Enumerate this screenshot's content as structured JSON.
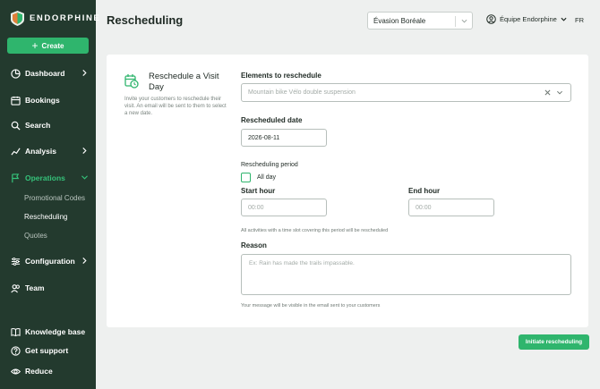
{
  "brand": {
    "name": "ENDORPHINE"
  },
  "sidebar": {
    "create_label": "Create",
    "items": [
      {
        "label": "Dashboard",
        "icon": "dashboard-icon"
      },
      {
        "label": "Bookings",
        "icon": "calendar-icon"
      },
      {
        "label": "Search",
        "icon": "search-icon"
      },
      {
        "label": "Analysis",
        "icon": "analysis-icon"
      },
      {
        "label": "Operations",
        "icon": "operations-icon"
      },
      {
        "label": "Configuration",
        "icon": "sliders-icon"
      },
      {
        "label": "Team",
        "icon": "team-icon"
      }
    ],
    "sub_items": [
      "Promotional Codes",
      "Rescheduling",
      "Quotes"
    ],
    "footer": [
      {
        "label": "Knowledge base",
        "icon": "book-icon"
      },
      {
        "label": "Get support",
        "icon": "help-icon"
      },
      {
        "label": "Reduce",
        "icon": "eye-icon"
      }
    ]
  },
  "header": {
    "title": "Rescheduling",
    "org_select": "Évasion Boréale",
    "user": "Équipe Endorphine",
    "lang": "FR"
  },
  "form": {
    "title": "Reschedule a Visit Day",
    "description": "Invite your customers to reschedule their visit. An email will be sent to them to select a new date.",
    "elements_label": "Elements to reschedule",
    "elements_value": "Mountain bike Vélo double suspension",
    "date_label": "Rescheduled date",
    "date_value": "2026-08-11",
    "period_label": "Rescheduling period",
    "all_day_label": "All day",
    "start_label": "Start hour",
    "start_placeholder": "00:00",
    "end_label": "End hour",
    "end_placeholder": "00:00",
    "period_help": "All activities with a time slot covering this period will be rescheduled",
    "reason_label": "Reason",
    "reason_placeholder": "Ex: Rain has made the trails impassable.",
    "reason_help": "Your message will be visible in the email sent to your customers",
    "submit_label": "Initiate rescheduling"
  },
  "colors": {
    "sidebar": "#233a2e",
    "accent": "#2fb56d",
    "background": "#eef0ef"
  }
}
